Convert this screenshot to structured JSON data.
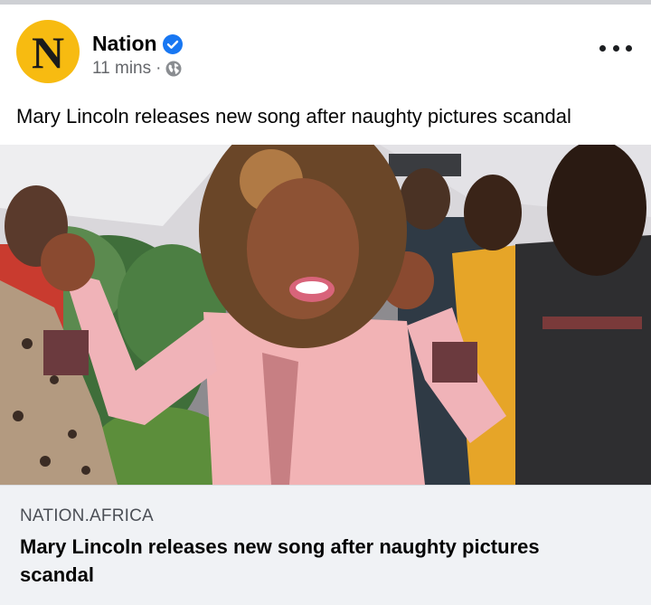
{
  "post": {
    "page_name": "Nation",
    "avatar_letter": "N",
    "time": "11 mins",
    "separator": "·",
    "privacy_icon": "globe-icon",
    "verified_icon": "verified-badge-icon",
    "more_icon": "more-options-icon",
    "caption": "Mary Lincoln releases new song after naughty pictures scandal"
  },
  "link_preview": {
    "domain": "NATION.AFRICA",
    "title": "Mary Lincoln releases new song after naughty pictures scandal"
  },
  "colors": {
    "avatar_bg": "#f7bb11",
    "verified": "#1877f2",
    "meta_text": "#65676b",
    "link_box_bg": "#f0f2f5"
  }
}
